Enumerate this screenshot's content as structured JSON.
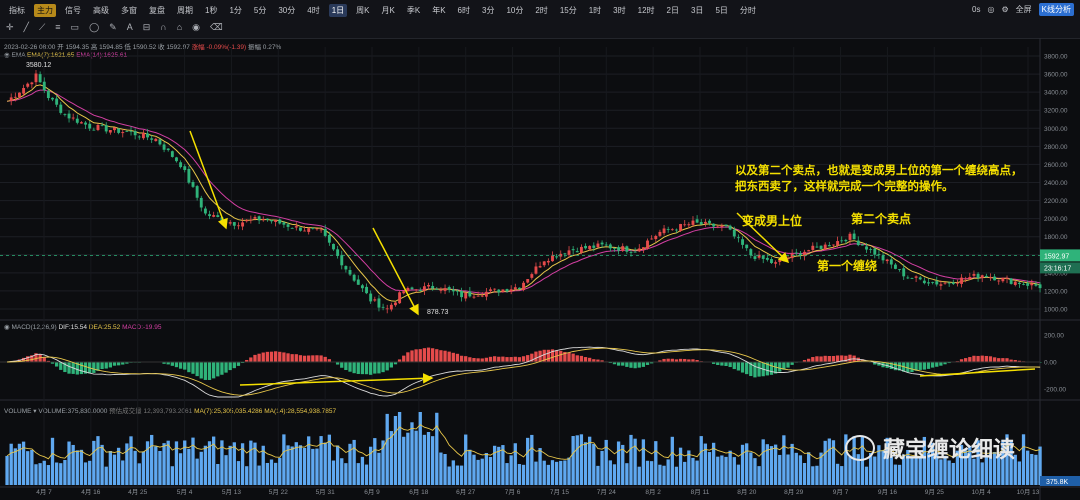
{
  "toolbar": {
    "row1": [
      "指标",
      "主力",
      "信号",
      "高级",
      "多窗",
      "复盘",
      "周期",
      "1秒",
      "1分",
      "5分",
      "30分",
      "4时",
      "1日",
      "周K",
      "月K",
      "季K",
      "年K",
      "6时",
      "3分",
      "10分",
      "2时",
      "15分",
      "1时",
      "3时",
      "12时",
      "2日",
      "3日",
      "5日",
      "分时"
    ],
    "right": [
      "0s",
      "全屏",
      "K线分析"
    ]
  },
  "ohlc": {
    "date": "2023-02-26 08:00",
    "open": "开 1594.35",
    "high": "高 1594.85",
    "low": "低 1590.52",
    "close": "收 1592.97",
    "change": "涨幅 -0.09%(-1.39)",
    "amp": "振幅 0.27%"
  },
  "ema_legend": {
    "name": "EMA",
    "ema7": "EMA(7):1621.65",
    "ema14": "EMA(14):1625.61"
  },
  "macd_legend": {
    "name": "MACD(12,26,9)",
    "dif": "DIF:15.54",
    "dea": "DEA:25.52",
    "macd": "MACD:-19.95"
  },
  "vol_legend": {
    "name": "VOLUME",
    "vol": "VOLUME:375,830.0000",
    "amount": "预估成交量 12,393,793.2061",
    "ma7": "MA(7):25,305,035.4286",
    "ma14": "MA(14):28,554,938.7857"
  },
  "price_tag": "1592.97",
  "time_tag": "23:16:17",
  "vol_tag": "375.8K",
  "annotations": {
    "para_line1": "以及第二个卖点，也就是变成男上位的第一个缠绕高点，",
    "para_line2": "把东西卖了，这样就完成一个完整的操作。",
    "male_top": "变成男上位",
    "second_sell": "第二个卖点",
    "first_wrap": "第一个缠绕",
    "hi_label": "3580.12",
    "lo_label": "878.73"
  },
  "watermark": "藏宝缠论细读",
  "colors": {
    "up": "#e54b4b",
    "down": "#2fb37a",
    "ema7": "#e7c64a",
    "ema14": "#d33fa2",
    "dif": "#d8d8d8",
    "dea": "#e7c64a",
    "arrow": "#f5e000"
  },
  "chart_data": [
    {
      "type": "candlestick",
      "title": "",
      "y_ticks": [
        1000,
        1200,
        1400,
        1600,
        1800,
        2000,
        2200,
        2400,
        2600,
        2800,
        3000,
        3200,
        3400,
        3600,
        3800
      ],
      "ylim": [
        900,
        3900
      ],
      "x_ticks": [
        "4月 7",
        "4月 16",
        "4月 25",
        "5月 4",
        "5月 13",
        "5月 22",
        "5月 31",
        "6月 9",
        "6月 18",
        "6月 27",
        "7月 6",
        "7月 15",
        "7月 24",
        "8月 2",
        "8月 11",
        "8月 20",
        "8月 29",
        "9月 7",
        "9月 16",
        "9月 25",
        "10月 4",
        "10月 13"
      ],
      "close_anchors": [
        [
          0,
          3300
        ],
        [
          4,
          3450
        ],
        [
          7,
          3580
        ],
        [
          10,
          3350
        ],
        [
          14,
          3150
        ],
        [
          20,
          3020
        ],
        [
          30,
          2950
        ],
        [
          36,
          2880
        ],
        [
          42,
          2600
        ],
        [
          48,
          2050
        ],
        [
          55,
          1950
        ],
        [
          62,
          2000
        ],
        [
          70,
          1900
        ],
        [
          76,
          1850
        ],
        [
          82,
          1450
        ],
        [
          88,
          1100
        ],
        [
          92,
          1000
        ],
        [
          96,
          1200
        ],
        [
          104,
          1250
        ],
        [
          110,
          1150
        ],
        [
          118,
          1200
        ],
        [
          124,
          1250
        ],
        [
          130,
          1550
        ],
        [
          136,
          1650
        ],
        [
          144,
          1700
        ],
        [
          152,
          1650
        ],
        [
          158,
          1850
        ],
        [
          166,
          1950
        ],
        [
          174,
          1900
        ],
        [
          180,
          1600
        ],
        [
          186,
          1500
        ],
        [
          192,
          1630
        ],
        [
          198,
          1700
        ],
        [
          204,
          1800
        ],
        [
          210,
          1620
        ],
        [
          218,
          1350
        ],
        [
          226,
          1280
        ],
        [
          236,
          1380
        ],
        [
          244,
          1300
        ],
        [
          250,
          1250
        ]
      ],
      "highlights": {
        "high": 3580.12,
        "low": 878.73
      }
    },
    {
      "type": "macd",
      "y_ticks": [
        200,
        0,
        -200
      ],
      "ylim": [
        -260,
        260
      ]
    },
    {
      "type": "bar",
      "title": "VOLUME"
    }
  ]
}
